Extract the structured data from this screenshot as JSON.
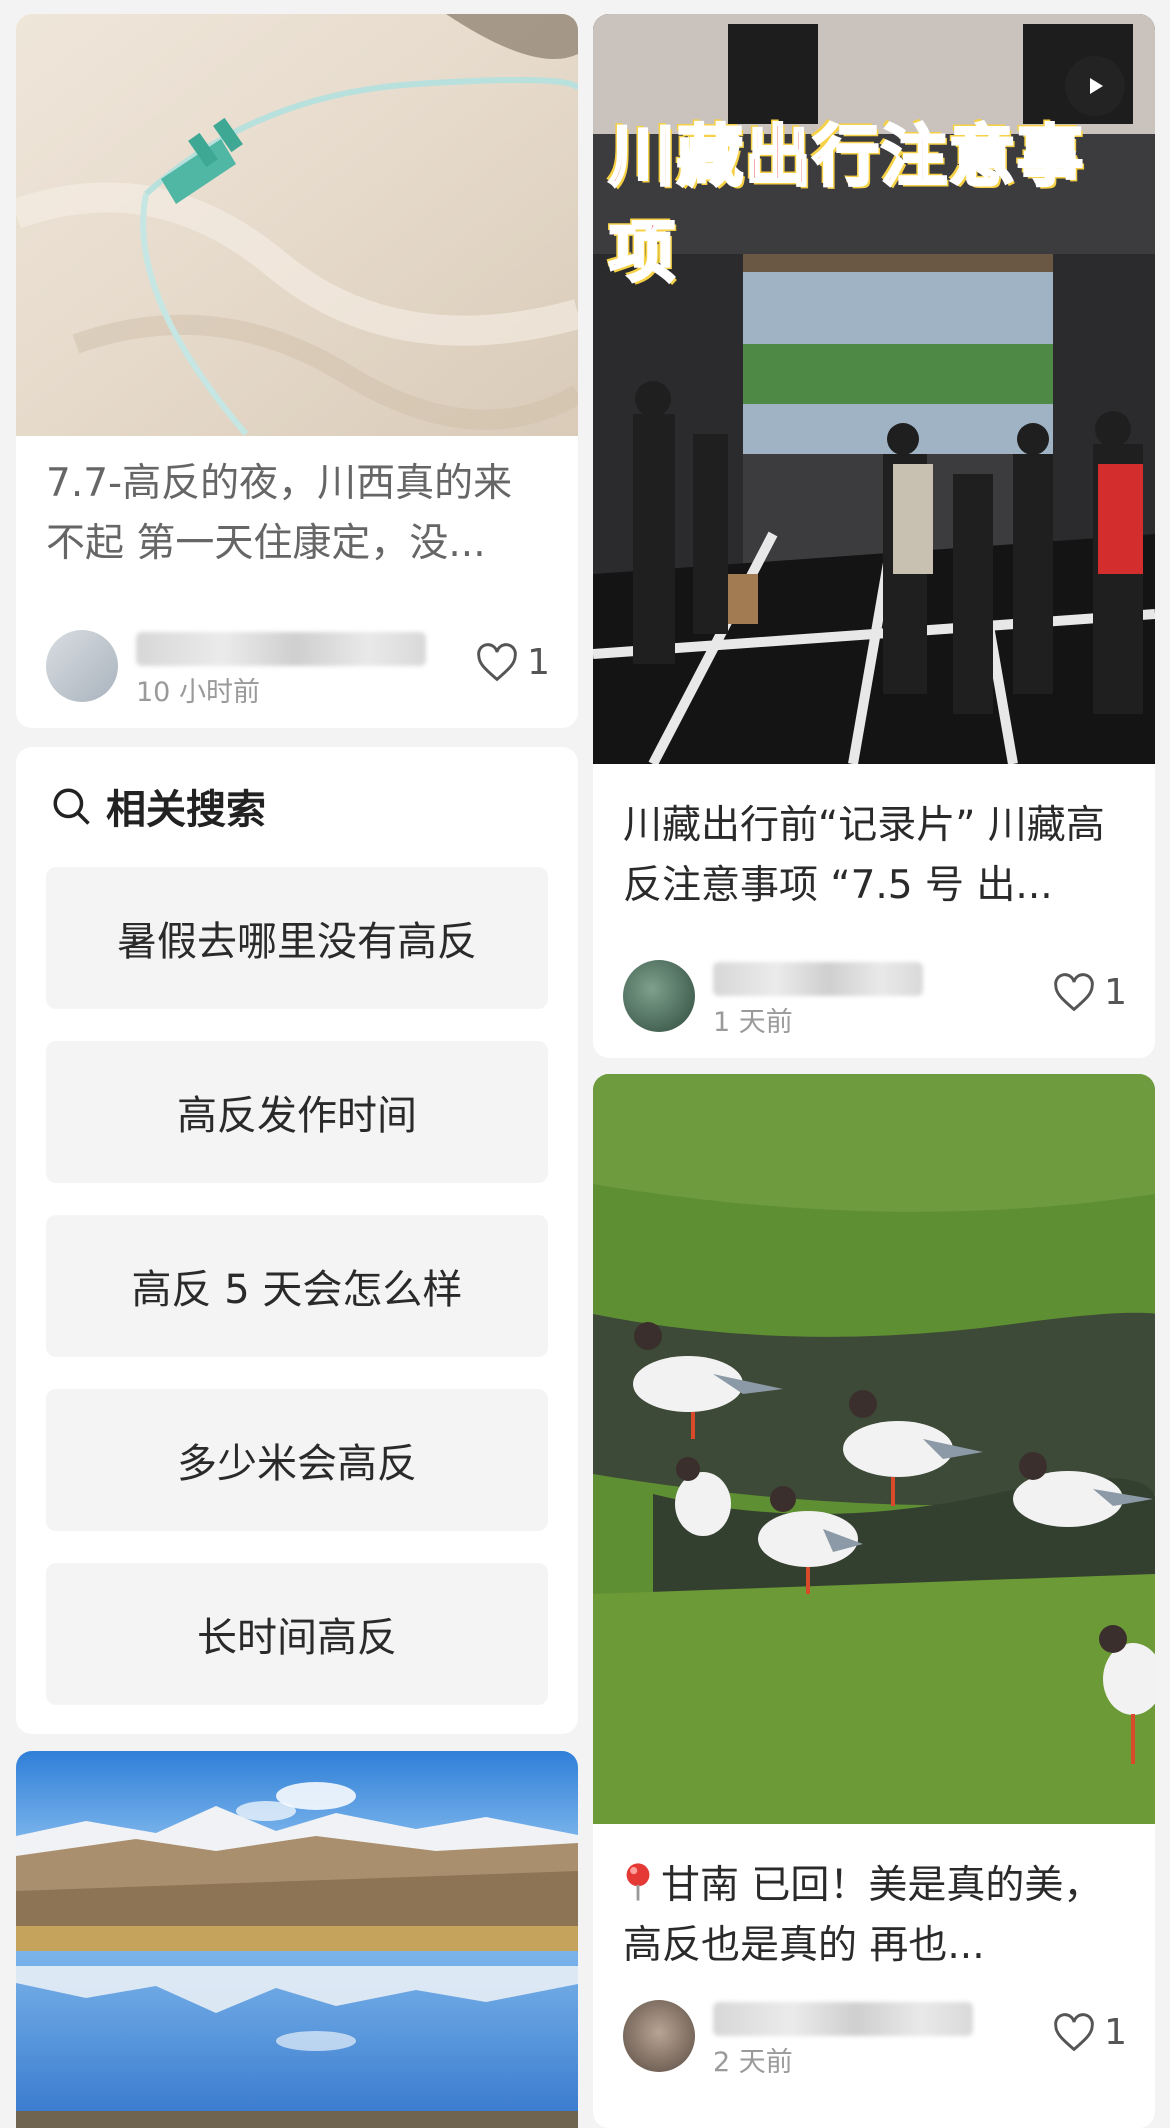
{
  "feed": {
    "card1": {
      "title": "7.7-高反的夜，川西真的来不起 第一天住康定，没...",
      "time": "10 小时前",
      "likes": "1",
      "image_icon": "oxygen-tube-photo"
    },
    "card2": {
      "banner": "川藏出行注意事项",
      "title": "川藏出行前“记录片” 川藏高反注意事项 “7.5 号 出...",
      "time": "1 天前",
      "likes": "1",
      "image_icon": "hotel-lobby-photo",
      "play_icon": "play-icon"
    },
    "card3": {
      "title": "甘南 已回！美是真的美，高反也是真的 再也...",
      "time": "2 天前",
      "likes": "1",
      "image_icon": "seagulls-grassland-photo",
      "pin_icon": "location-pin-icon"
    },
    "card4": {
      "image_icon": "snow-mountain-lake-photo"
    }
  },
  "related": {
    "heading": "相关搜索",
    "items": [
      "暑假去哪里没有高反",
      "高反发作时间",
      "高反 5 天会怎么样",
      "多少米会高反",
      "长时间高反"
    ]
  },
  "colors": {
    "page_bg": "#f3f3f3",
    "card_bg": "#ffffff",
    "chip_bg": "#f4f4f4",
    "accent_red": "#e01b1b"
  }
}
